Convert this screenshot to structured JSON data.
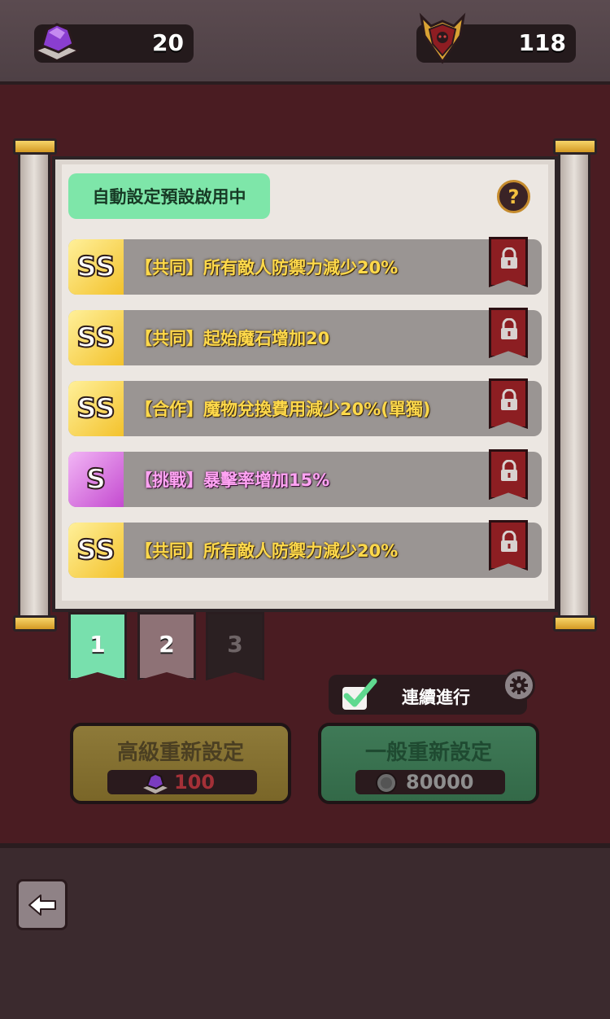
{
  "topbar": {
    "gems": "20",
    "trophies": "118"
  },
  "panel": {
    "auto_badge": "自動設定預設啟用中",
    "help_label": "?",
    "options": [
      {
        "grade": "SS",
        "text": "【共同】所有敵人防禦力減少20%",
        "color": "#ffd94a"
      },
      {
        "grade": "SS",
        "text": "【共同】起始魔石增加20",
        "color": "#ffd94a"
      },
      {
        "grade": "SS",
        "text": "【合作】魔物兌換費用減少20%(單獨)",
        "color": "#ffd94a"
      },
      {
        "grade": "S",
        "text": "【挑戰】暴擊率增加15%",
        "color": "#ffa3f3"
      },
      {
        "grade": "SS",
        "text": "【共同】所有敵人防禦力減少20%",
        "color": "#ffd94a"
      }
    ]
  },
  "pages": [
    "1",
    "2",
    "3"
  ],
  "continue": {
    "label": "連續進行"
  },
  "reset": {
    "advanced_title": "高級重新設定",
    "advanced_cost": "100",
    "normal_title": "一般重新設定",
    "normal_cost": "80000"
  },
  "icons": {
    "gem": "purple-gem-icon",
    "trophy": "skull-trophy-icon",
    "lock": "lock-icon",
    "gear": "gear-icon",
    "back": "back-arrow-icon",
    "coin": "coin-icon"
  },
  "colors": {
    "ss_grade": "#f3c22c",
    "s_grade": "#c44bd0",
    "active_tab": "#78e0ad",
    "auto_badge": "#7ee6a9"
  }
}
